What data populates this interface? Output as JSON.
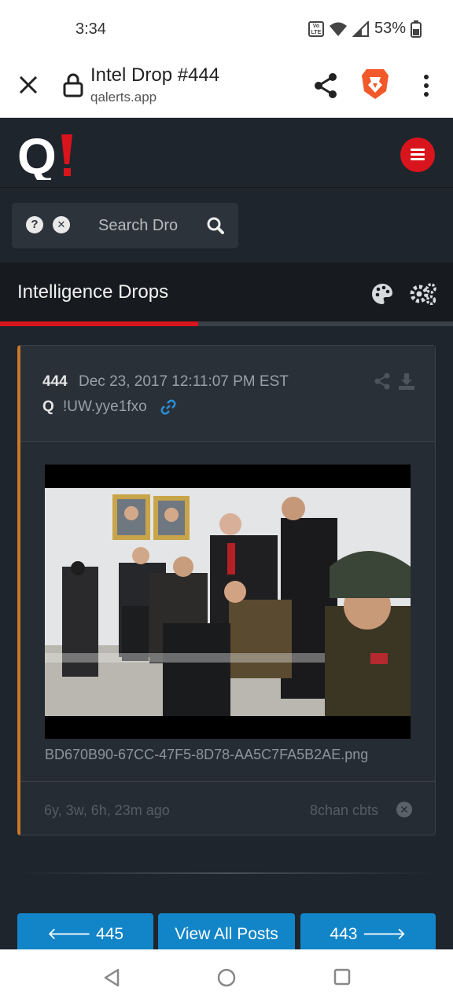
{
  "status_bar": {
    "time": "3:34",
    "battery": "53%",
    "volte_line1": "Vo",
    "volte_line2": "LTE"
  },
  "browser": {
    "page_title": "Intel Drop #444",
    "url": "qalerts.app"
  },
  "site": {
    "logo_letter": "Q",
    "search_placeholder": "Search Dro",
    "help_glyph": "?",
    "clear_glyph": "✕"
  },
  "section": {
    "title": "Intelligence Drops"
  },
  "post": {
    "number": "444",
    "date": "Dec 23, 2017 12:11:07 PM EST",
    "author": "Q",
    "tripcode": "!UW.yye1fxo",
    "image_filename": "BD670B90-67CC-47F5-8D78-AA5C7FA5B2AE.png",
    "age": "6y, 3w, 6h, 23m ago",
    "source": "8chan cbts",
    "source_remove_glyph": "✕"
  },
  "navigation": {
    "prev_label": "🡐 445",
    "all_label": "View All Posts",
    "next_label": "443 🡒"
  },
  "colors": {
    "accent_red": "#d8141c",
    "nav_blue": "#1185c8",
    "card_border_orange": "#c9782a"
  }
}
